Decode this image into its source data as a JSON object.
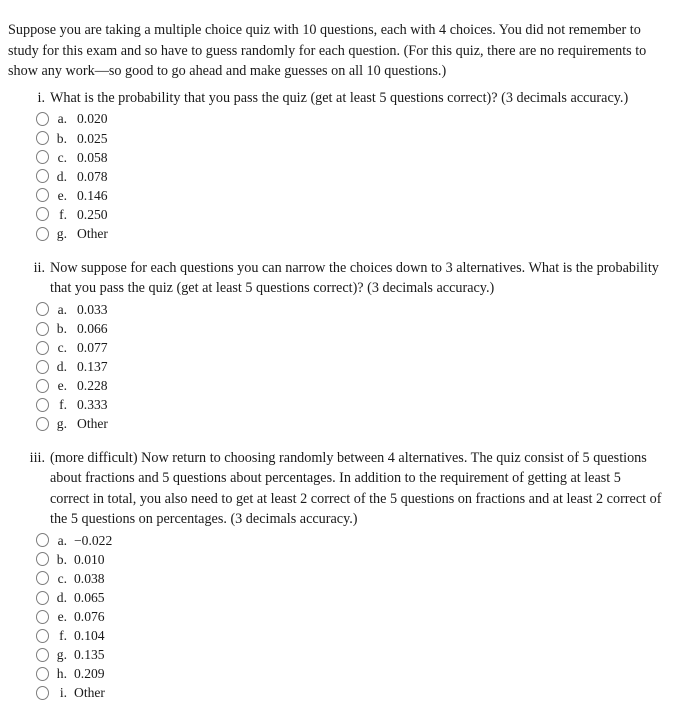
{
  "document": {
    "intro": "Suppose you are taking a multiple choice quiz with 10 questions, each with 4 choices. You did not remember to study for this exam and so have to guess randomly for each question. (For this quiz, there are no requirements to show any work—so good to go ahead and make guesses on all 10 questions.)"
  },
  "questions": [
    {
      "numeral": "i.",
      "prompt": "What is the probability that you pass the quiz (get at least 5 questions correct)? (3 decimals accuracy.)",
      "options": [
        {
          "letter": "a.",
          "value": "0.020"
        },
        {
          "letter": "b.",
          "value": "0.025"
        },
        {
          "letter": "c.",
          "value": "0.058"
        },
        {
          "letter": "d.",
          "value": "0.078"
        },
        {
          "letter": "e.",
          "value": "0.146"
        },
        {
          "letter": "f.",
          "value": "0.250"
        },
        {
          "letter": "g.",
          "value": "Other"
        }
      ]
    },
    {
      "numeral": "ii.",
      "prompt": "Now suppose for each questions you can narrow the choices down to 3 alternatives. What is the probability that you pass the quiz (get at least 5 questions correct)? (3 decimals accuracy.)",
      "options": [
        {
          "letter": "a.",
          "value": "0.033"
        },
        {
          "letter": "b.",
          "value": "0.066"
        },
        {
          "letter": "c.",
          "value": "0.077"
        },
        {
          "letter": "d.",
          "value": "0.137"
        },
        {
          "letter": "e.",
          "value": "0.228"
        },
        {
          "letter": "f.",
          "value": "0.333"
        },
        {
          "letter": "g.",
          "value": "Other"
        }
      ]
    },
    {
      "numeral": "iii.",
      "prompt": "(more difficult) Now return to choosing randomly between 4 alternatives. The quiz consist of 5 questions about fractions and 5 questions about percentages. In addition to the requirement of getting at least 5 correct in total, you also need to get at least 2 correct of the 5 questions on fractions and at least 2 correct of the 5 questions on percentages. (3 decimals accuracy.)",
      "options": [
        {
          "letter": "a.",
          "value": "−0.022"
        },
        {
          "letter": "b.",
          "value": "0.010"
        },
        {
          "letter": "c.",
          "value": "0.038"
        },
        {
          "letter": "d.",
          "value": "0.065"
        },
        {
          "letter": "e.",
          "value": "0.076"
        },
        {
          "letter": "f.",
          "value": "0.104"
        },
        {
          "letter": "g.",
          "value": "0.135"
        },
        {
          "letter": "h.",
          "value": "0.209"
        },
        {
          "letter": "i.",
          "value": "Other"
        }
      ]
    }
  ]
}
